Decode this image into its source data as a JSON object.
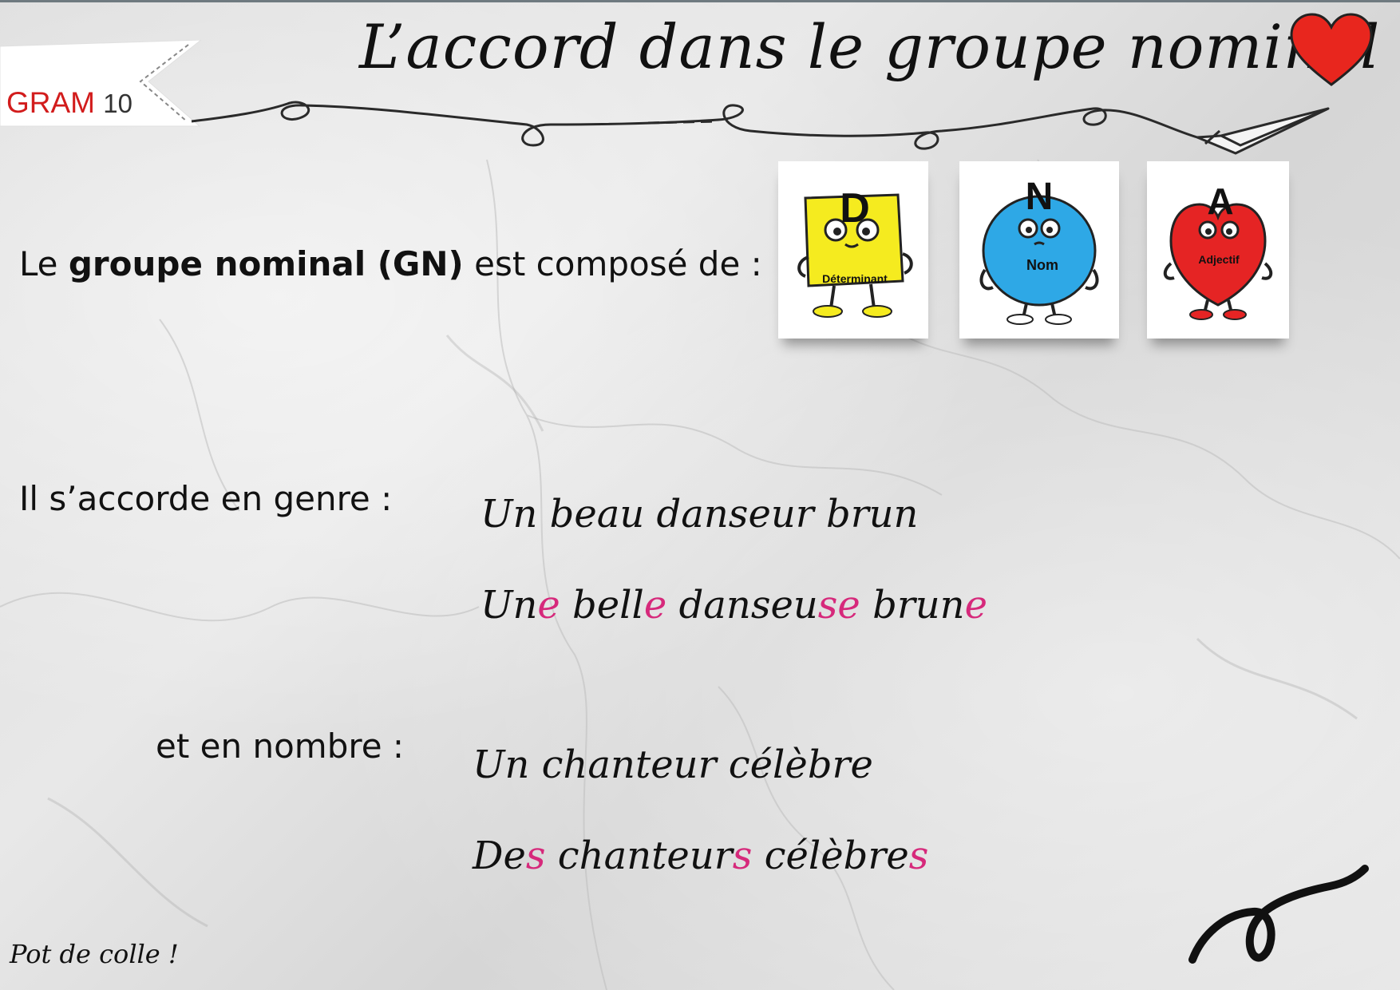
{
  "header": {
    "tag_prefix": "GRAM ",
    "tag_number": "10",
    "title": "L’accord dans le groupe nominal"
  },
  "intro": {
    "before": "Le ",
    "bold": "groupe nominal (GN)",
    "after": " est composé de :"
  },
  "cards": [
    {
      "letter": "D",
      "label": "Déterminant",
      "color": "#f5eb1f"
    },
    {
      "letter": "N",
      "label": "Nom",
      "color": "#2ea8e6"
    },
    {
      "letter": "A",
      "label": "Adjectif",
      "color": "#e52424"
    }
  ],
  "genre": {
    "label": "Il s’accorde en genre  :",
    "ex1": "Un beau danseur brun",
    "ex2": {
      "w1a": "Un",
      "w1b": "e",
      "w2a": "bell",
      "w2b": "e",
      "w3a": "danseu",
      "w3b": "se",
      "w4a": "brun",
      "w4b": "e"
    }
  },
  "nombre": {
    "label": "et en nombre  :",
    "ex1": "Un chanteur célèbre",
    "ex2": {
      "w1a": "De",
      "w1b": "s",
      "w2a": "chanteur",
      "w2b": "s",
      "w3a": "célèbre",
      "w3b": "s"
    }
  },
  "footer": "Pot de colle !",
  "colors": {
    "accent_pink": "#d6297b",
    "tag_red": "#d21c1c",
    "heart": "#e8261e"
  }
}
